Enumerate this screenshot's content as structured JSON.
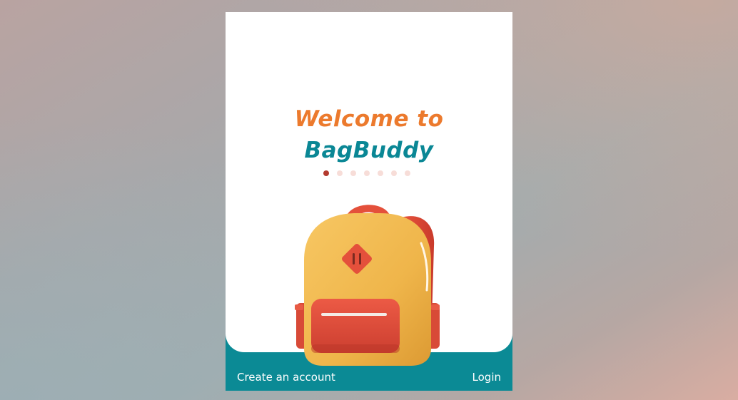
{
  "onboarding": {
    "title_line1": "Welcome to",
    "title_line2": "BagBuddy",
    "carousel": {
      "total_slides": 7,
      "active_index": 0
    },
    "illustration": "backpack-illustration"
  },
  "footer": {
    "create_account_label": "Create an account",
    "login_label": "Login"
  },
  "colors": {
    "accent_orange": "#ec7a2d",
    "brand_teal": "#0a8795",
    "footer_teal": "#0b8a95",
    "active_dot": "#b33a2f",
    "inactive_dot": "#f7ddd8"
  }
}
